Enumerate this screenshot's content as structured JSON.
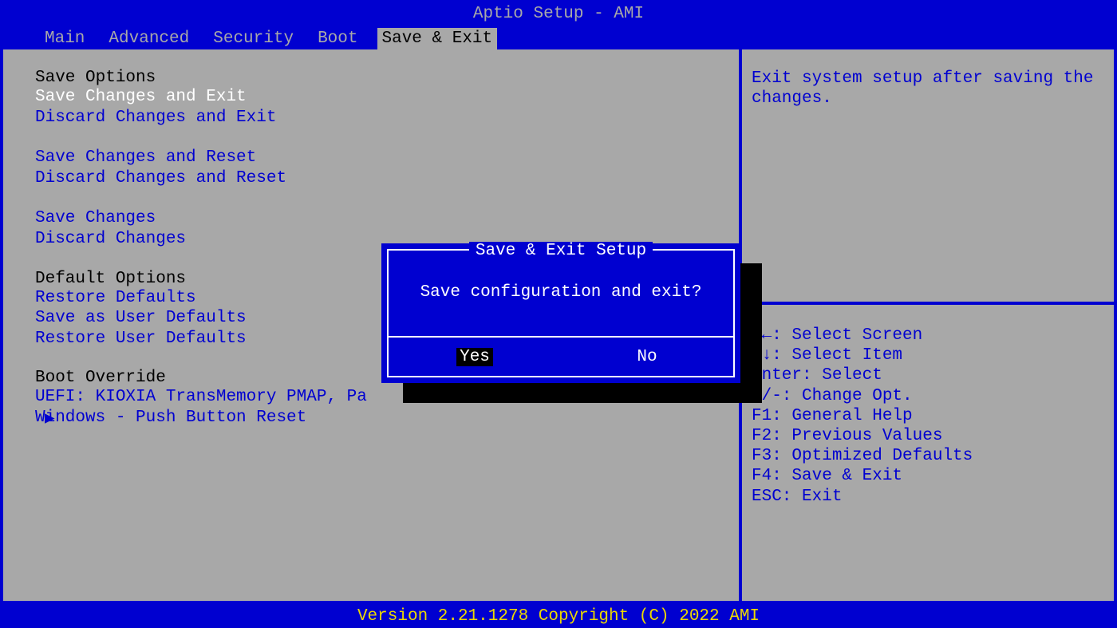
{
  "header": {
    "title": "Aptio Setup - AMI"
  },
  "tabs": {
    "items": [
      {
        "label": "Main"
      },
      {
        "label": "Advanced"
      },
      {
        "label": "Security"
      },
      {
        "label": "Boot"
      },
      {
        "label": "Save & Exit"
      }
    ]
  },
  "left": {
    "section1_header": "Save Options",
    "item_save_exit": "Save Changes and Exit",
    "item_discard_exit": "Discard Changes and Exit",
    "item_save_reset": "Save Changes and Reset",
    "item_discard_reset": "Discard Changes and Reset",
    "item_save": "Save Changes",
    "item_discard": "Discard Changes",
    "section2_header": "Default Options",
    "item_restore_defaults": "Restore Defaults",
    "item_save_user_defaults": "Save as User Defaults",
    "item_restore_user_defaults": "Restore User Defaults",
    "section3_header": "Boot Override",
    "item_uefi": "UEFI: KIOXIA TransMemory PMAP, Pa",
    "item_windows": "Windows - Push Button Reset",
    "arrow": "▶"
  },
  "help": {
    "text": "Exit system setup after saving the changes.",
    "keys": [
      "→←: Select Screen",
      "↑↓: Select Item",
      "Enter: Select",
      "+/-: Change Opt.",
      "F1: General Help",
      "F2: Previous Values",
      "F3: Optimized Defaults",
      "F4: Save & Exit",
      "ESC: Exit"
    ]
  },
  "dialog": {
    "title": "Save & Exit Setup",
    "message": "Save configuration and exit?",
    "yes": "Yes",
    "no": "No"
  },
  "footer": {
    "version": "Version 2.21.1278 Copyright (C) 2022 AMI"
  }
}
